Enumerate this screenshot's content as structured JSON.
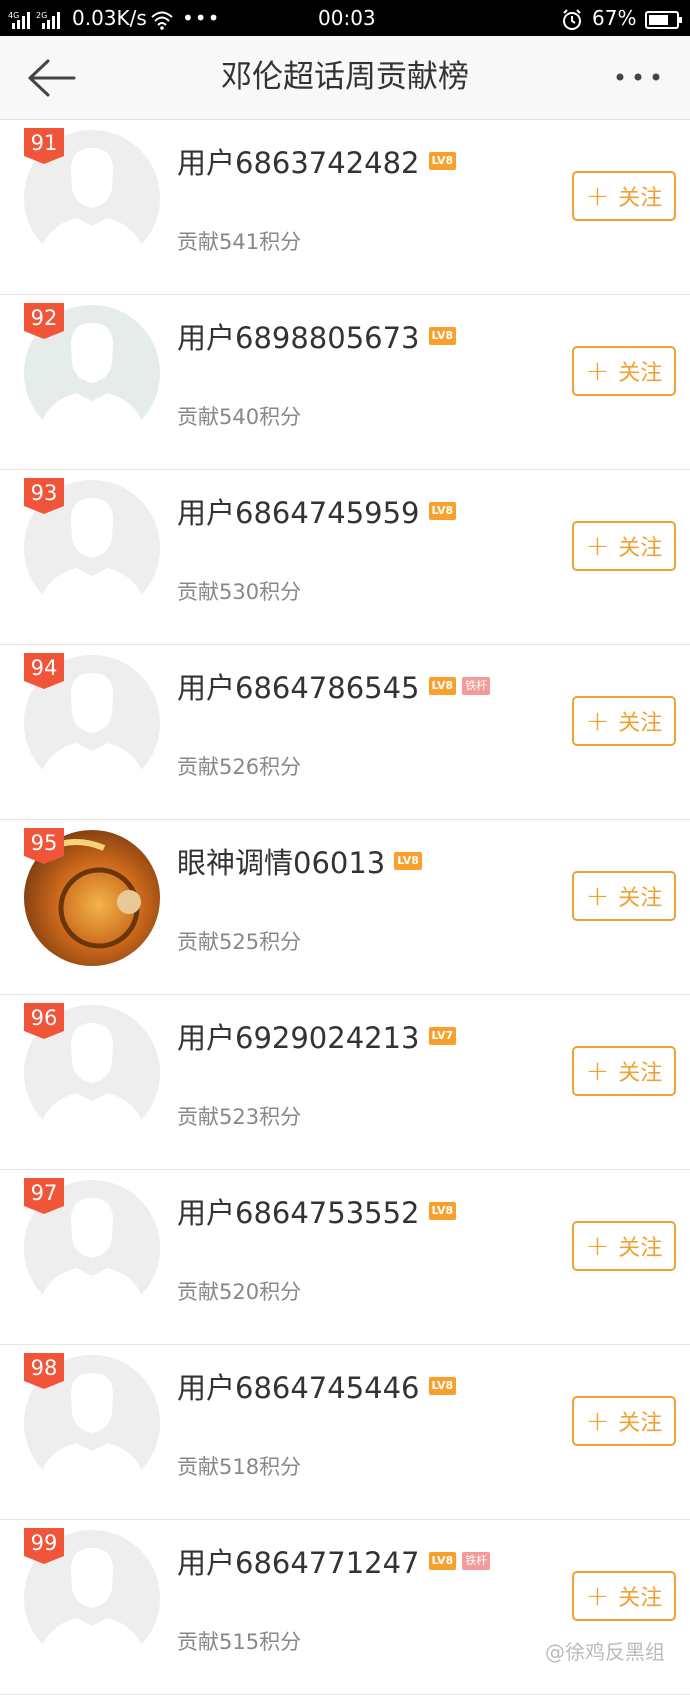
{
  "status_bar": {
    "net1": "4G",
    "net2": "2G",
    "speed": "0.03K/s",
    "dots": "•••",
    "time": "00:03",
    "battery": "67%"
  },
  "nav": {
    "title": "邓伦超话周贡献榜"
  },
  "follow_label": "关注",
  "rows": [
    {
      "rank": "91",
      "name": "用户6863742482",
      "level": "LV8",
      "badge": "",
      "score": "贡献541积分"
    },
    {
      "rank": "92",
      "name": "用户6898805673",
      "level": "LV8",
      "badge": "",
      "score": "贡献540积分"
    },
    {
      "rank": "93",
      "name": "用户6864745959",
      "level": "LV8",
      "badge": "",
      "score": "贡献530积分"
    },
    {
      "rank": "94",
      "name": "用户6864786545",
      "level": "LV8",
      "badge": "铁杆",
      "score": "贡献526积分"
    },
    {
      "rank": "95",
      "name": "眼神调情06013",
      "level": "LV8",
      "badge": "",
      "score": "贡献525积分"
    },
    {
      "rank": "96",
      "name": "用户6929024213",
      "level": "LV7",
      "badge": "",
      "score": "贡献523积分"
    },
    {
      "rank": "97",
      "name": "用户6864753552",
      "level": "LV8",
      "badge": "",
      "score": "贡献520积分"
    },
    {
      "rank": "98",
      "name": "用户6864745446",
      "level": "LV8",
      "badge": "",
      "score": "贡献518积分"
    },
    {
      "rank": "99",
      "name": "用户6864771247",
      "level": "LV8",
      "badge": "铁杆",
      "score": "贡献515积分"
    }
  ],
  "watermark": "@徐鸡反黑组",
  "colors": {
    "accent": "#f0a132",
    "rank_badge": "#f0553a",
    "level_badge": "#f8a02b",
    "tiegan_badge": "#f39a9a"
  }
}
